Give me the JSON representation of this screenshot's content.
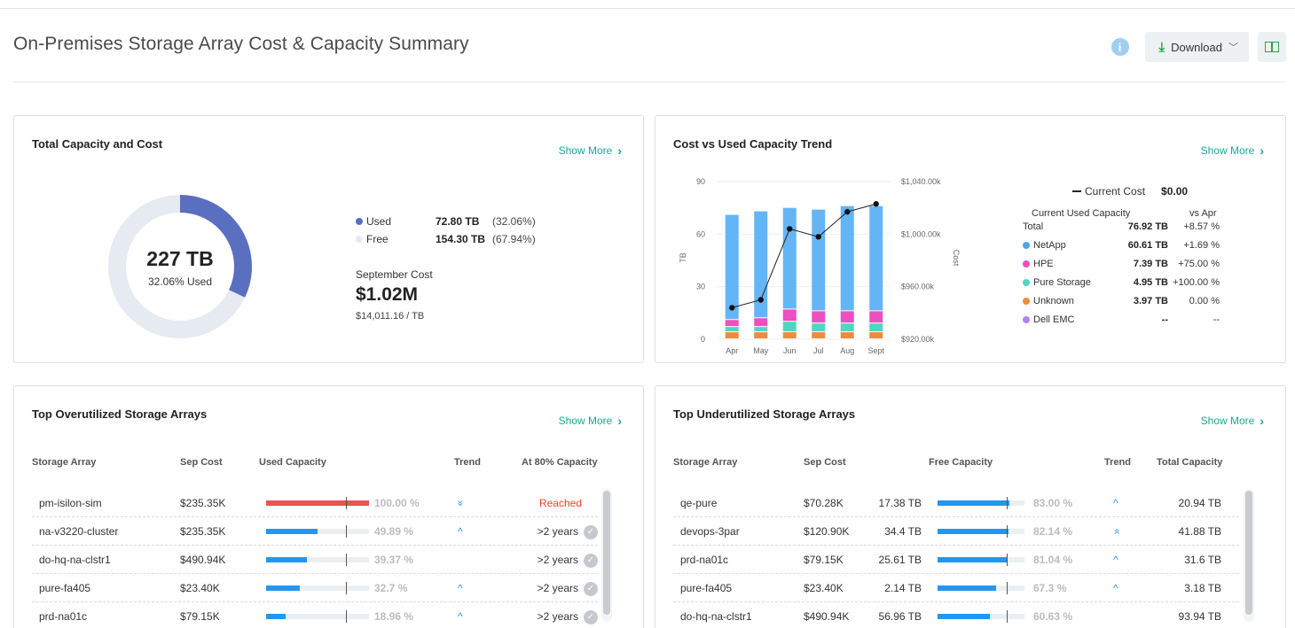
{
  "header": {
    "title": "On-Premises Storage Array Cost & Capacity Summary",
    "info_icon": "i",
    "download_label": "Download"
  },
  "capacity_card": {
    "title": "Total Capacity and Cost",
    "show_more": "Show More",
    "donut_value": "227 TB",
    "donut_sub": "32.06% Used",
    "used_fraction": 0.3206,
    "legend": [
      {
        "label": "Used",
        "tb": "72.80 TB",
        "pct": "(32.06%)",
        "color": "#5b6fc0"
      },
      {
        "label": "Free",
        "tb": "154.30 TB",
        "pct": "(67.94%)",
        "color": "#e6eaf1"
      }
    ],
    "cost_label": "September Cost",
    "cost_value": "$1.02M",
    "cost_per_tb": "$14,011.16 / TB"
  },
  "trend_card": {
    "title": "Cost vs Used Capacity Trend",
    "show_more": "Show More",
    "left_axis_label": "TB",
    "right_axis_label": "Cost",
    "current_cost_label": "Current Cost",
    "current_cost_value": "$0.00",
    "capacity_header": "Current Used Capacity",
    "vs_header": "vs Apr",
    "rows": [
      {
        "name": "Total",
        "value": "76.92 TB",
        "pct": "+8.57 %",
        "color": ""
      },
      {
        "name": "NetApp",
        "value": "60.61 TB",
        "pct": "+1.69 %",
        "color": "#4aa8ef"
      },
      {
        "name": "HPE",
        "value": "7.39 TB",
        "pct": "+75.00 %",
        "color": "#ec4fc0"
      },
      {
        "name": "Pure Storage",
        "value": "4.95 TB",
        "pct": "+100.00 %",
        "color": "#4fd6c0"
      },
      {
        "name": "Unknown",
        "value": "3.97 TB",
        "pct": "0.00 %",
        "color": "#f08a3e"
      },
      {
        "name": "Dell EMC",
        "value": "--",
        "pct": "--",
        "color": "#b184ef"
      }
    ]
  },
  "chart_data": {
    "type": "bar",
    "categories": [
      "Apr",
      "May",
      "Jun",
      "Jul",
      "Aug",
      "Sept"
    ],
    "series": [
      {
        "name": "Unknown",
        "values": [
          4,
          4,
          4,
          4,
          4,
          4
        ],
        "color": "#f08a3e"
      },
      {
        "name": "Pure Storage",
        "values": [
          3,
          3,
          6,
          5,
          5,
          5
        ],
        "color": "#4fd6c0"
      },
      {
        "name": "HPE",
        "values": [
          4,
          5,
          7,
          7,
          7,
          7
        ],
        "color": "#ec4fc0"
      },
      {
        "name": "NetApp",
        "values": [
          60,
          61,
          58,
          58,
          60,
          60
        ],
        "color": "#64b5f6"
      }
    ],
    "line": {
      "name": "Current Cost",
      "values": [
        944,
        950,
        1004,
        998,
        1017,
        1023
      ]
    },
    "left_ticks": [
      "0",
      "30",
      "60",
      "90"
    ],
    "ylim": [
      0,
      90
    ],
    "right_ticks": [
      "$920.00k",
      "$960.00k",
      "$1,000.00k",
      "$1,040.00k"
    ],
    "y2lim": [
      920,
      1040
    ],
    "xlabel": "",
    "ylabel": "TB",
    "y2label": "Cost"
  },
  "over_card": {
    "title": "Top Overutilized Storage Arrays",
    "show_more": "Show More",
    "headers": [
      "Storage Array",
      "Sep Cost",
      "Used Capacity",
      "Trend",
      "At 80% Capacity"
    ],
    "rows": [
      {
        "name": "pm-isilon-sim",
        "cost": "$235.35K",
        "pct": "100.00 %",
        "fill": 1.0,
        "trend": "»",
        "status": "Reached",
        "check": false
      },
      {
        "name": "na-v3220-cluster",
        "cost": "$235.35K",
        "pct": "49.89 %",
        "fill": 0.4989,
        "trend": "^",
        "status": ">2 years",
        "check": true
      },
      {
        "name": "do-hq-na-clstr1",
        "cost": "$490.94K",
        "pct": "39.37 %",
        "fill": 0.3937,
        "trend": "",
        "status": ">2 years",
        "check": true
      },
      {
        "name": "pure-fa405",
        "cost": "$23.40K",
        "pct": "32.7 %",
        "fill": 0.327,
        "trend": "^",
        "status": ">2 years",
        "check": true
      },
      {
        "name": "prd-na01c",
        "cost": "$79.15K",
        "pct": "18.96 %",
        "fill": 0.1896,
        "trend": "^",
        "status": ">2 years",
        "check": true
      }
    ]
  },
  "under_card": {
    "title": "Top Underutilized Storage Arrays",
    "show_more": "Show More",
    "headers": [
      "Storage Array",
      "Sep Cost",
      "Free Capacity",
      "Trend",
      "Total Capacity"
    ],
    "rows": [
      {
        "name": "qe-pure",
        "cost": "$70.28K",
        "free": "17.38 TB",
        "pct": "83.00 %",
        "fill": 0.83,
        "trend": "^",
        "total": "20.94 TB"
      },
      {
        "name": "devops-3par",
        "cost": "$120.90K",
        "free": "34.4 TB",
        "pct": "82.14 %",
        "fill": 0.8214,
        "trend": "»",
        "total": "41.88 TB"
      },
      {
        "name": "prd-na01c",
        "cost": "$79.15K",
        "free": "25.61 TB",
        "pct": "81.04 %",
        "fill": 0.8104,
        "trend": "^",
        "total": "31.6 TB"
      },
      {
        "name": "pure-fa405",
        "cost": "$23.40K",
        "free": "2.14 TB",
        "pct": "67.3 %",
        "fill": 0.673,
        "trend": "^",
        "total": "3.18 TB"
      },
      {
        "name": "do-hq-na-clstr1",
        "cost": "$490.94K",
        "free": "56.96 TB",
        "pct": "60.63 %",
        "fill": 0.6063,
        "trend": "",
        "total": "93.94 TB"
      }
    ]
  }
}
